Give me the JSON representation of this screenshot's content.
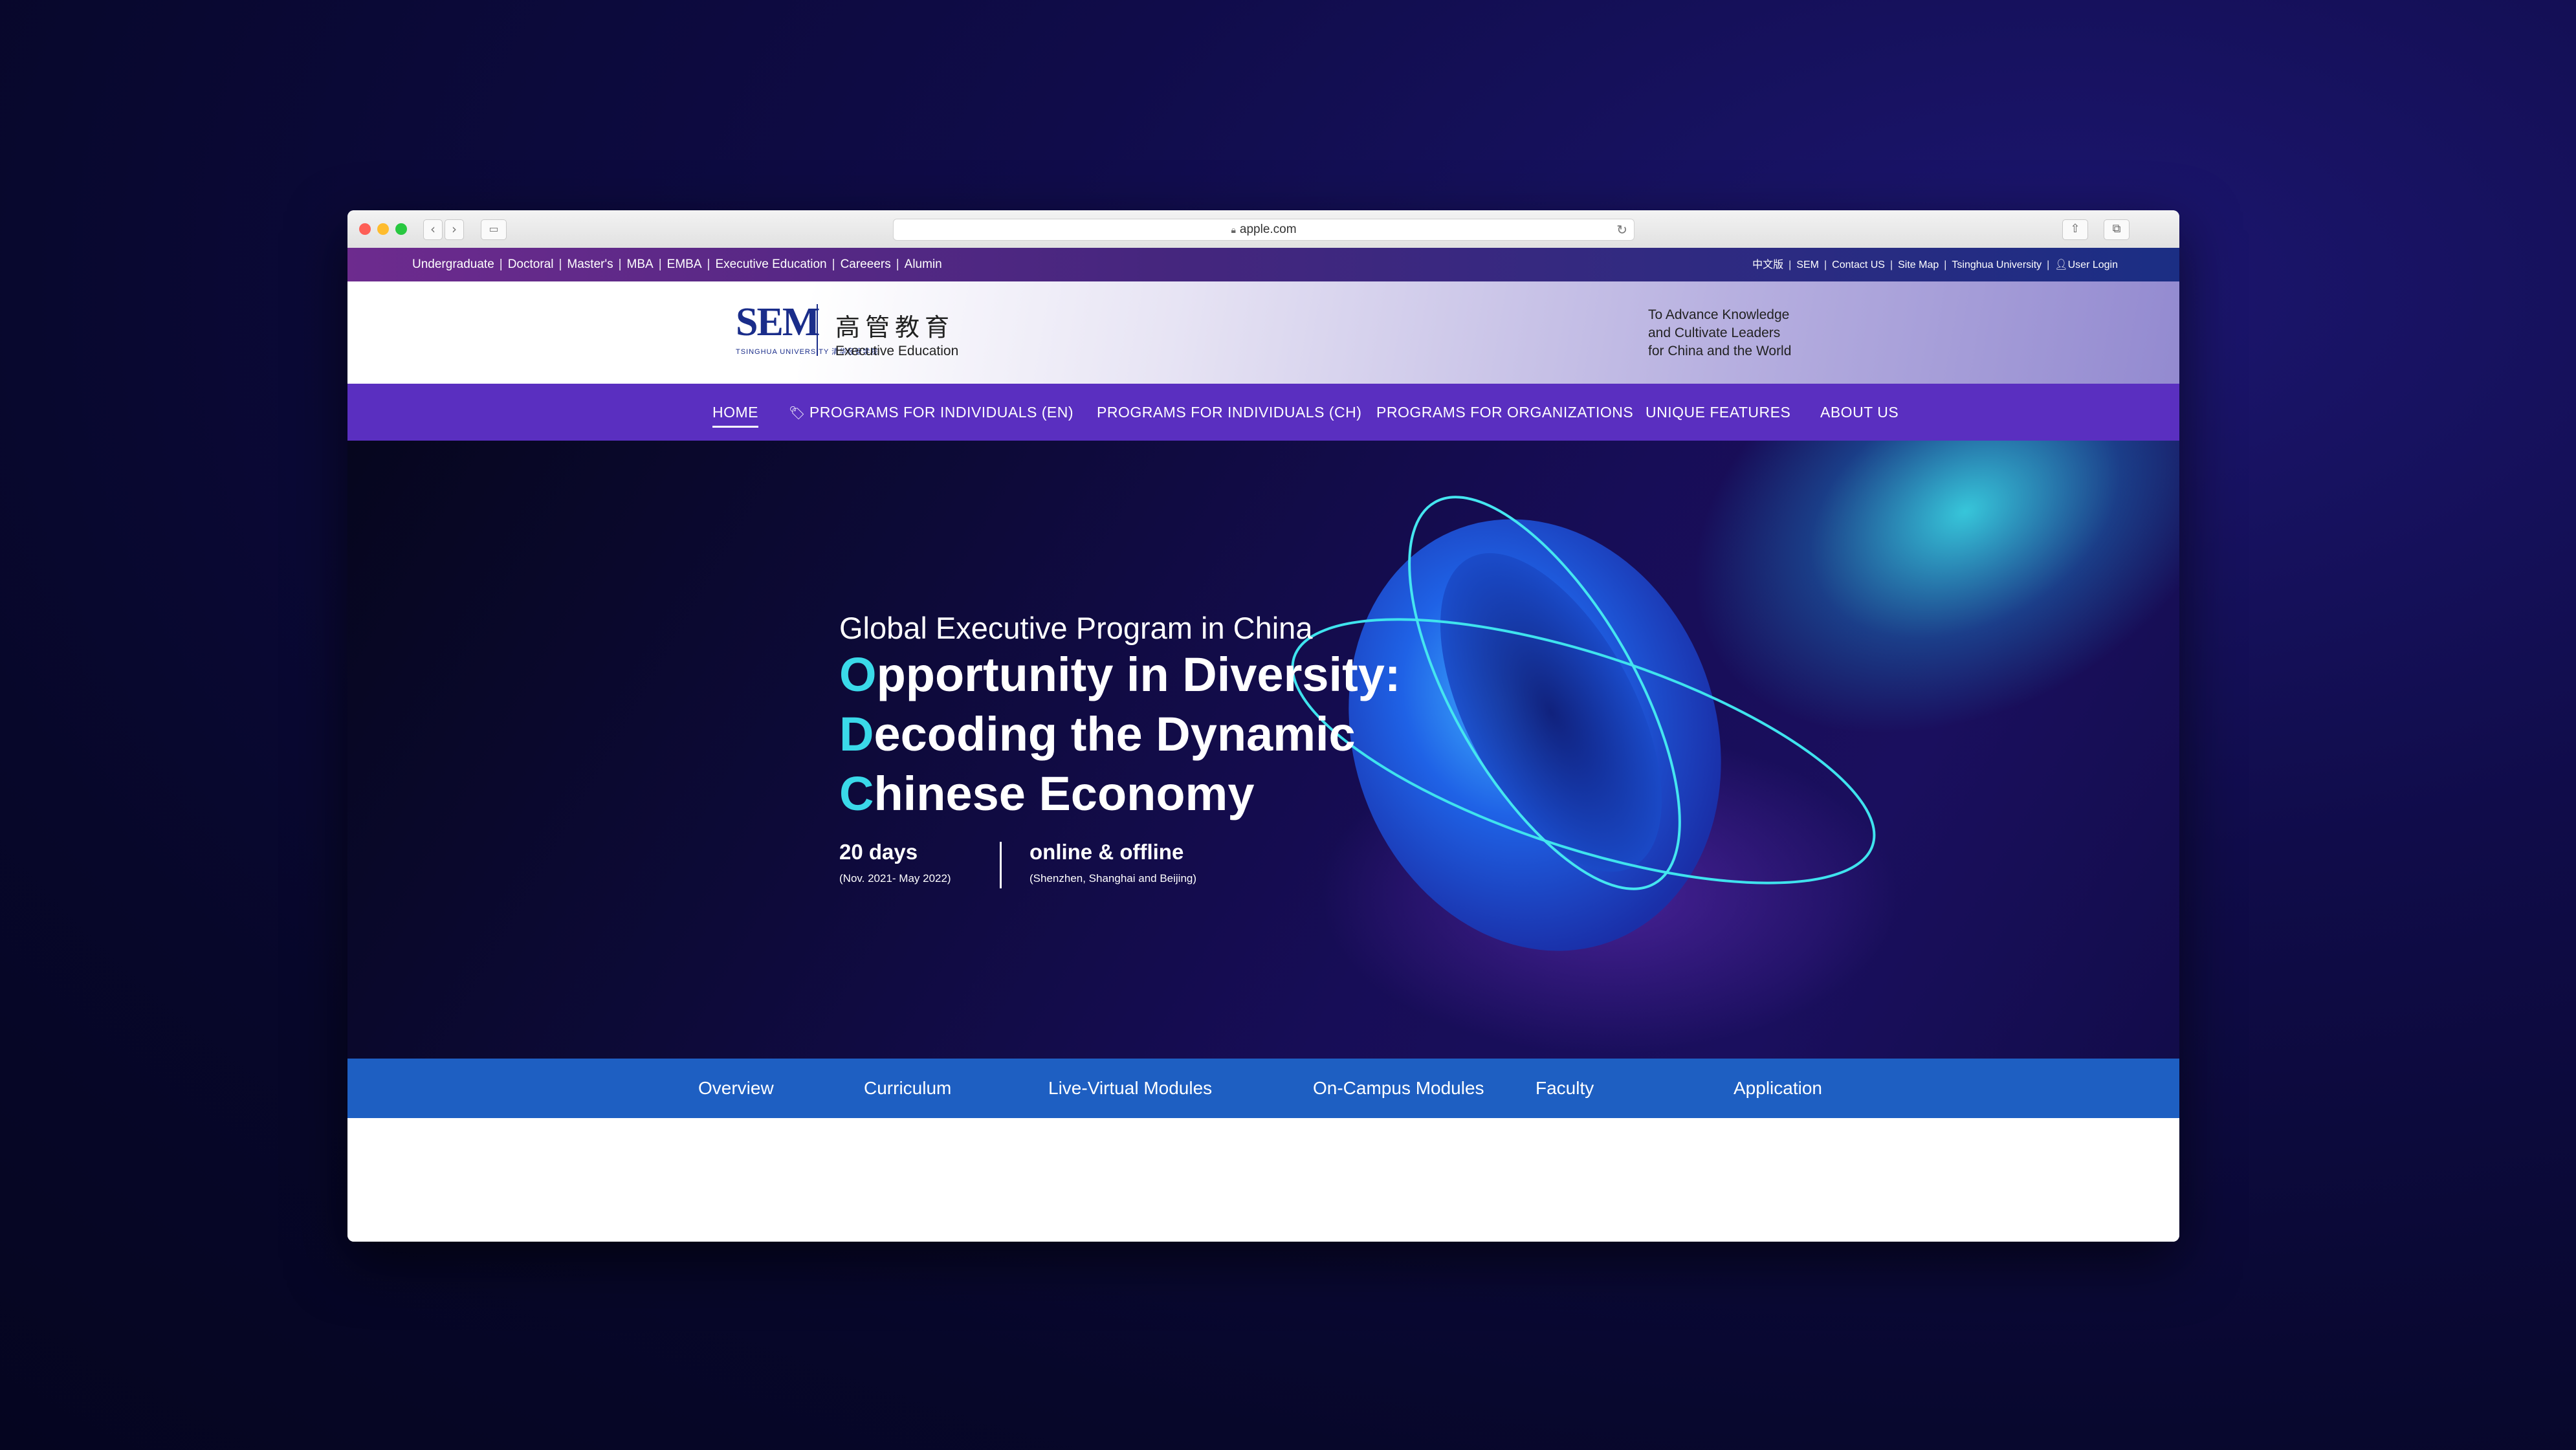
{
  "browser": {
    "url": "apple.com",
    "icons": [
      "back-icon",
      "forward-icon",
      "sidebar-icon",
      "lock-icon",
      "reload-icon",
      "share-icon",
      "tabs-icon"
    ]
  },
  "topbar": {
    "left_links": [
      "Undergraduate",
      "Doctoral",
      "Master's",
      "MBA",
      "EMBA",
      "Executive Education",
      "Careeers",
      "Alumin"
    ],
    "right_links": [
      "中文版",
      "SEM",
      "Contact US",
      "Site Map",
      "Tsinghua University",
      "User Login"
    ]
  },
  "header": {
    "logo_text": "SEM",
    "logo_sub": "TSINGHUA UNIVERSITY 清华经管学院",
    "logo_cn": "高管教育",
    "logo_en": "Executive Education",
    "tagline": [
      "To Advance Knowledge",
      "and Cultivate Leaders",
      "for China and the World"
    ]
  },
  "mainnav": {
    "items": [
      "HOME",
      "PROGRAMS FOR INDIVIDUALS (EN)",
      "PROGRAMS FOR INDIVIDUALS (CH)",
      "PROGRAMS FOR ORGANIZATIONS",
      "UNIQUE FEATURES",
      "ABOUT US"
    ],
    "active": "HOME"
  },
  "hero": {
    "subtitle": "Global Executive Program in China",
    "title_lines": [
      {
        "cap": "O",
        "rest": "pportunity in Diversity:"
      },
      {
        "cap": "D",
        "rest": "ecoding the Dynamic"
      },
      {
        "cap": "C",
        "rest": "hinese Economy"
      }
    ],
    "stats": [
      {
        "value": "20 days",
        "detail": "(Nov. 2021- May 2022)"
      },
      {
        "value": "online & offline",
        "detail": "(Shenzhen, Shanghai and Beijing)"
      }
    ]
  },
  "subnav": {
    "items": [
      "Overview",
      "Curriculum",
      "Live-Virtual Modules",
      "On-Campus Modules",
      "Faculty",
      "Application"
    ]
  },
  "colors": {
    "topbar": "#45267e",
    "mainnav": "#5a2fc0",
    "subnav": "#1e5fc2",
    "accent_cyan": "#3ad9e9",
    "logo_blue": "#1a2d8a"
  }
}
